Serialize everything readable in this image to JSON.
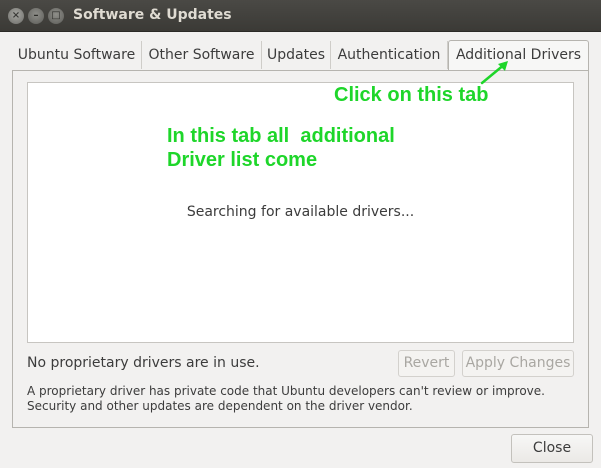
{
  "window": {
    "title": "Software & Updates"
  },
  "tabs": [
    {
      "label": "Ubuntu Software"
    },
    {
      "label": "Other Software"
    },
    {
      "label": "Updates"
    },
    {
      "label": "Authentication"
    },
    {
      "label": "Additional Drivers",
      "selected": true
    }
  ],
  "drivers": {
    "searching_text": "Searching for available drivers...",
    "status_text": "No proprietary drivers are in use.",
    "revert_label": "Revert",
    "apply_label": "Apply Changes",
    "description": "A proprietary driver has private code that Ubuntu developers can't review or improve. Security and other updates are dependent on the driver vendor."
  },
  "annotations": {
    "tab_hint": "Click on this tab",
    "list_hint_line1": "In this tab all  additional",
    "list_hint_line2": "Driver list come",
    "color": "#1ed62a"
  },
  "footer": {
    "close_label": "Close"
  }
}
